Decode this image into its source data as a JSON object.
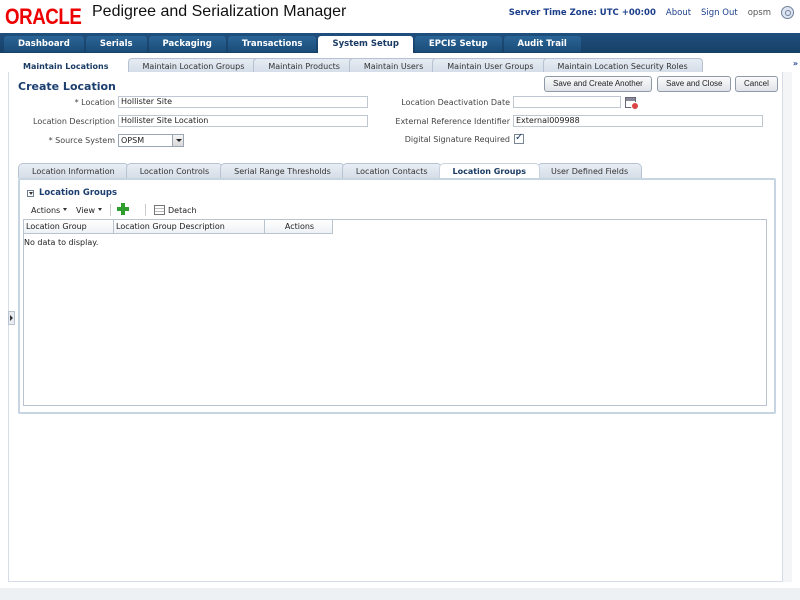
{
  "header": {
    "logo": "ORACLE",
    "app_title": "Pedigree and Serialization Manager",
    "server_time_zone": "Server Time Zone: UTC +00:00",
    "about": "About",
    "sign_out": "Sign Out",
    "user": "opsm"
  },
  "main_tabs": [
    "Dashboard",
    "Serials",
    "Packaging",
    "Transactions",
    "System Setup",
    "EPCIS Setup",
    "Audit Trail"
  ],
  "sub_tabs": [
    "Maintain Locations",
    "Maintain Location Groups",
    "Maintain Products",
    "Maintain Users",
    "Maintain User Groups",
    "Maintain Location Security Roles"
  ],
  "sub_more": "»",
  "page_title": "Create Location",
  "buttons": {
    "save_create_another": "Save and Create Another",
    "save_close": "Save and Close",
    "cancel": "Cancel"
  },
  "form": {
    "location_label": "* Location",
    "location_value": "Hollister Site",
    "description_label": "Location Description",
    "description_value": "Hollister Site Location",
    "source_system_label": "* Source System",
    "source_system_value": "OPSM",
    "deactivation_label": "Location Deactivation Date",
    "deactivation_value": "",
    "ext_ref_label": "External Reference Identifier",
    "ext_ref_value": "External009988",
    "digital_sig_label": "Digital Signature Required",
    "digital_sig_checked": true
  },
  "detail_tabs": [
    "Location Information",
    "Location Controls",
    "Serial Range Thresholds",
    "Location Contacts",
    "Location Groups",
    "User Defined Fields"
  ],
  "section": {
    "title": "Location Groups",
    "actions": "Actions",
    "view": "View",
    "detach": "Detach",
    "columns": [
      "Location Group",
      "Location Group Description",
      "Actions"
    ],
    "no_data": "No data to display."
  }
}
